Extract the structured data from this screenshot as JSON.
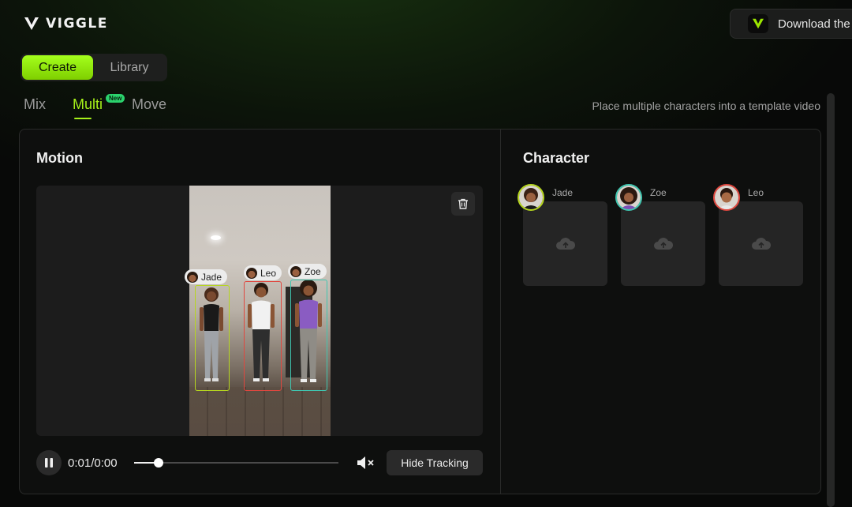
{
  "app": {
    "logo_text": "VIGGLE"
  },
  "header": {
    "download_label": "Download the"
  },
  "mode_toggle": {
    "create": "Create",
    "library": "Library"
  },
  "subtabs": [
    {
      "label": "Mix",
      "active": false
    },
    {
      "label": "Multi",
      "active": true,
      "badge": "New"
    },
    {
      "label": "Move",
      "active": false
    }
  ],
  "hint": "Place multiple characters into a template video",
  "motion": {
    "title": "Motion",
    "tracks": [
      {
        "name": "Jade",
        "color": "#b6d61f"
      },
      {
        "name": "Leo",
        "color": "#e0473f"
      },
      {
        "name": "Zoe",
        "color": "#3fc7b1"
      }
    ],
    "time": "0:01/0:00",
    "progress": 0.12,
    "hide_tracking": "Hide Tracking"
  },
  "character": {
    "title": "Character",
    "slots": [
      {
        "name": "Jade",
        "color": "#b6d61f"
      },
      {
        "name": "Zoe",
        "color": "#3fc7b1"
      },
      {
        "name": "Leo",
        "color": "#e0473f"
      }
    ]
  },
  "colors": {
    "accent": "#a6f21a",
    "panel_bg": "#0e0f0e"
  }
}
